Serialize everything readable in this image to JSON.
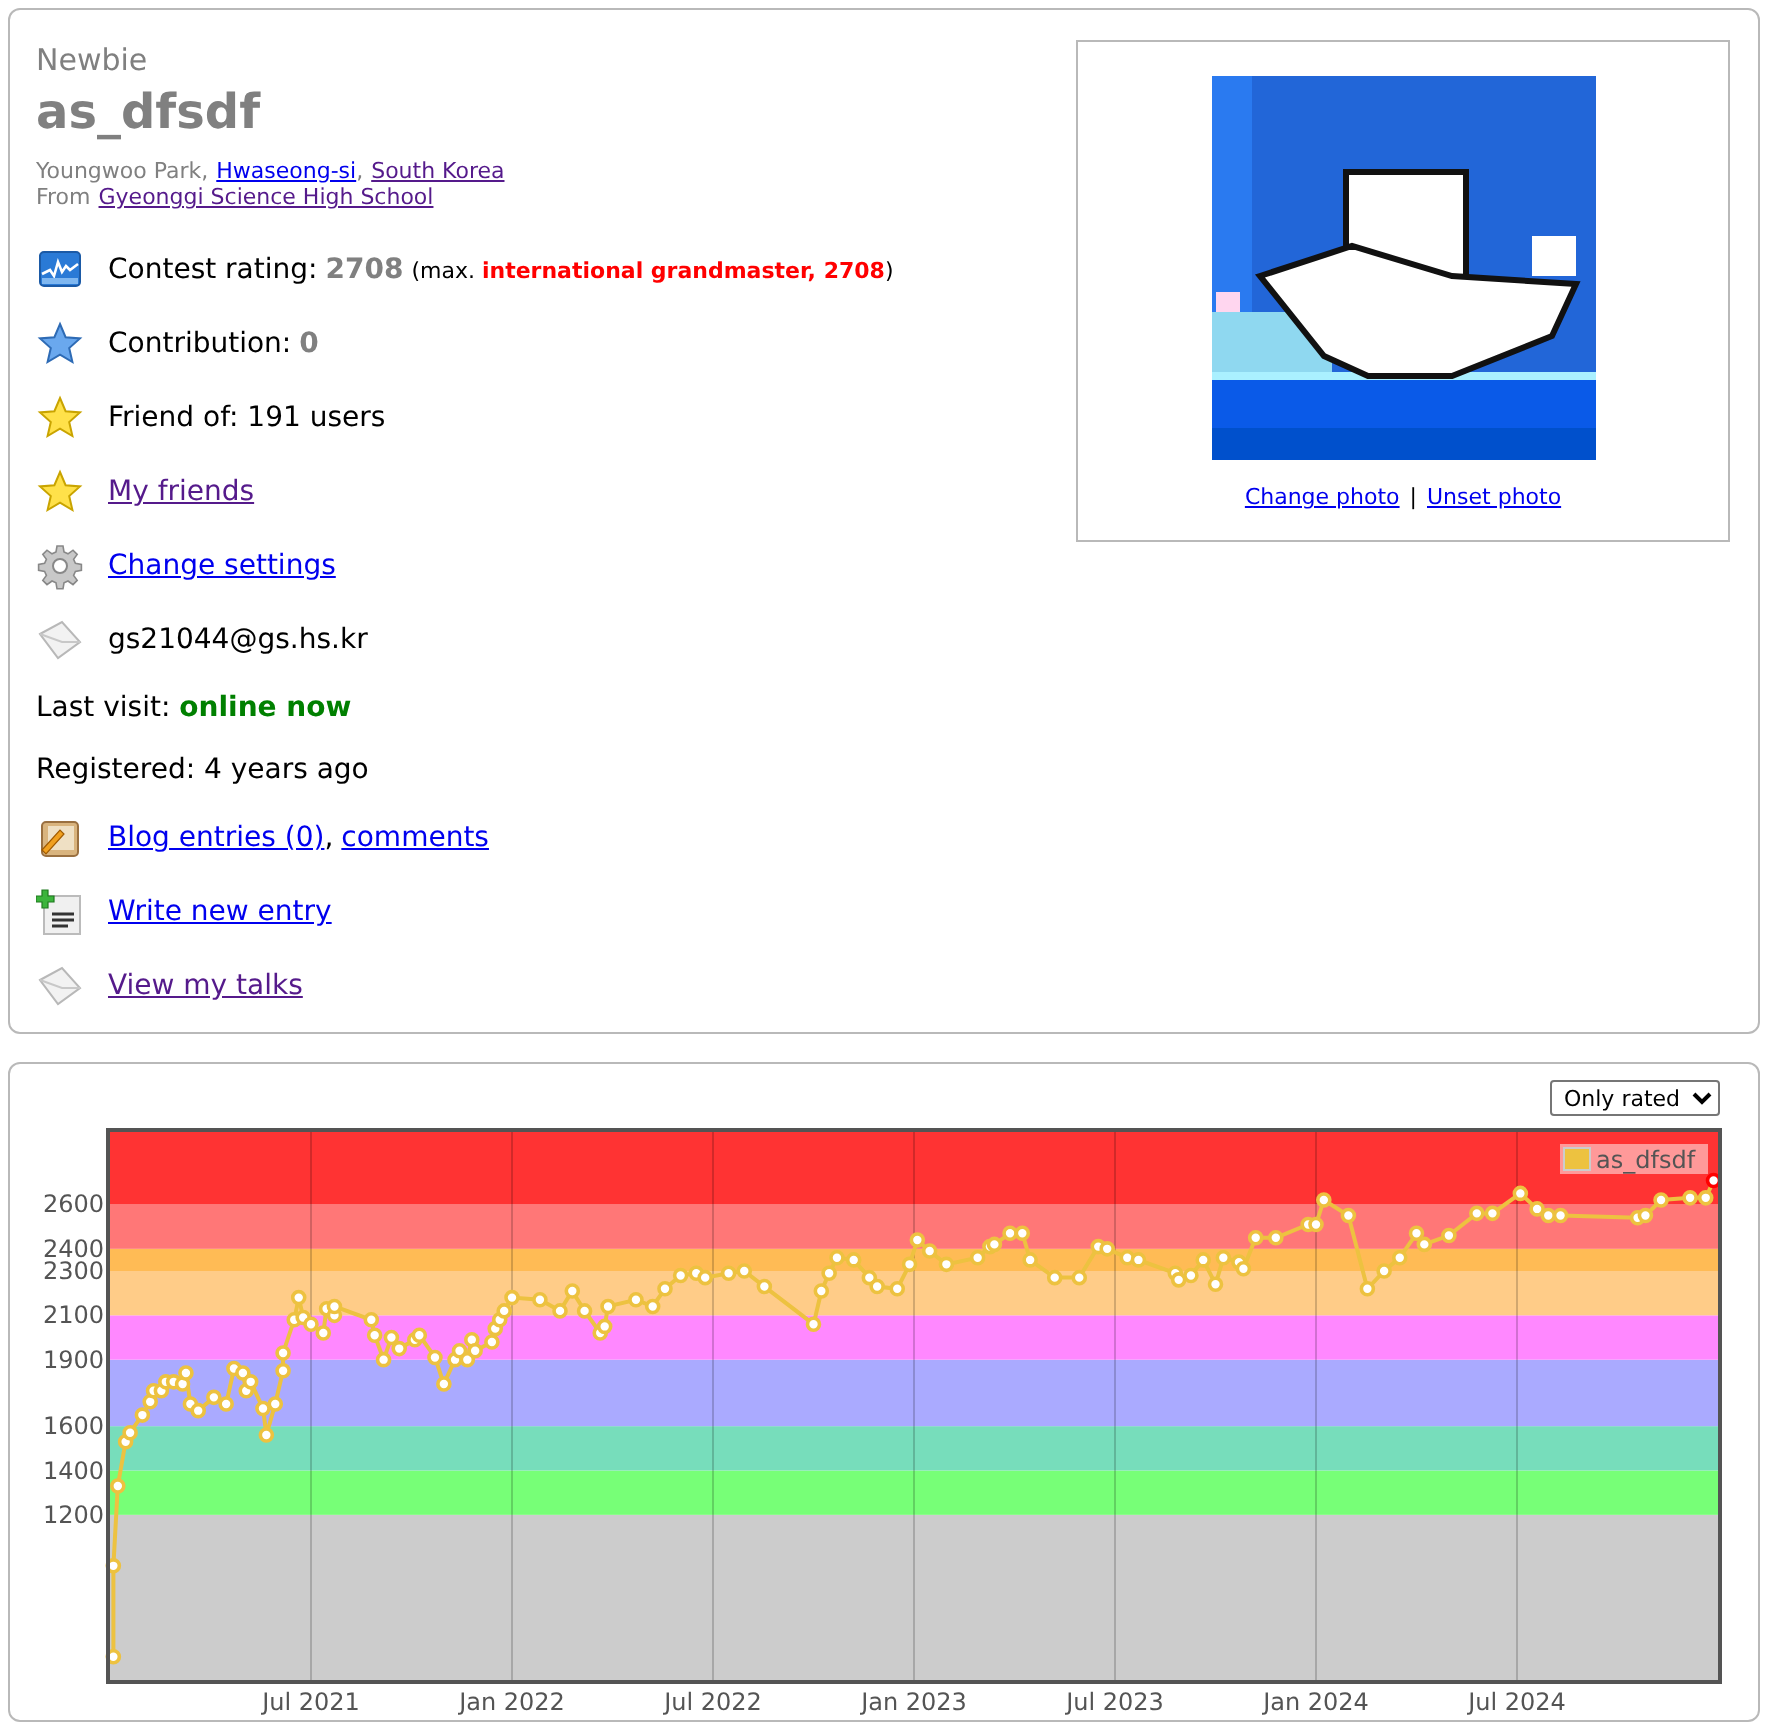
{
  "profile": {
    "rank": "Newbie",
    "handle": "as_dfsdf",
    "name_line": [
      {
        "kind": "text",
        "text": "Youngwoo Park,"
      },
      {
        "kind": "link",
        "text": "Hwaseong-si",
        "visited": false
      },
      {
        "kind": "text",
        "text": ","
      },
      {
        "kind": "link",
        "text": "South Korea",
        "visited": true
      }
    ],
    "organization_line": [
      {
        "kind": "text",
        "text": "From"
      },
      {
        "kind": "link",
        "text": "Gyeonggi Science High School",
        "visited": true
      }
    ],
    "rows": [
      {
        "kind": "rating",
        "label": "Contest rating:",
        "value": "2708",
        "max": "(max. **international grandmaster, 2708**)"
      },
      {
        "kind": "stat",
        "label": "Contribution:",
        "value": "0"
      },
      {
        "kind": "plain",
        "text": "Friend of: 191 users"
      },
      {
        "kind": "link",
        "text": "My friends",
        "visited": true
      },
      {
        "kind": "link",
        "text": "Change settings",
        "visited": false
      },
      {
        "kind": "plain",
        "text": "gs21044@gs.hs.kr"
      },
      {
        "kind": "status",
        "text": "Last visit: **online now**"
      },
      {
        "kind": "plain",
        "text": "Registered: 4 years ago"
      },
      {
        "kind": "links",
        "links": [
          {
            "text": "Blog entries (0)",
            "visited": false
          },
          {
            "text": "comments",
            "visited": false
          }
        ],
        "separator": ","
      },
      {
        "kind": "link",
        "text": "Write new entry",
        "visited": false
      },
      {
        "kind": "link",
        "text": "View my talks",
        "visited": true
      }
    ]
  },
  "photo": {
    "kind": "picture",
    "links": [
      {
        "text": "Change photo",
        "visited": false
      },
      {
        "text": "Unset photo",
        "visited": false
      }
    ],
    "separator": "|"
  },
  "rating_chart": {
    "filter": {
      "value": "Only rated"
    },
    "chart_data": {
      "type": "line",
      "grid": true,
      "bands": [
        {
          "axis": "y",
          "from": 455,
          "to": 1200,
          "color": "#cccccc"
        },
        {
          "axis": "y",
          "from": 1200,
          "to": 1400,
          "color": "#77ff77"
        },
        {
          "axis": "y",
          "from": 1400,
          "to": 1600,
          "color": "#77ddbb"
        },
        {
          "axis": "y",
          "from": 1600,
          "to": 1900,
          "color": "#aaaaff"
        },
        {
          "axis": "y",
          "from": 1900,
          "to": 2100,
          "color": "#ff88ff"
        },
        {
          "axis": "y",
          "from": 2100,
          "to": 2300,
          "color": "#ffcc88"
        },
        {
          "axis": "y",
          "from": 2300,
          "to": 2400,
          "color": "#ffbb55"
        },
        {
          "axis": "y",
          "from": 2400,
          "to": 2600,
          "color": "#ff7777"
        },
        {
          "axis": "y",
          "from": 2600,
          "to": 2927,
          "color": "#ff3333"
        }
      ],
      "xlim": [
        "2021-01-01",
        "2025-01-01"
      ],
      "ylim": [
        455,
        2927
      ],
      "xticks": [
        {
          "value": "2021-07-01",
          "label": "Jul 2021"
        },
        {
          "value": "2022-01-01",
          "label": "Jan 2022"
        },
        {
          "value": "2022-07-01",
          "label": "Jul 2022"
        },
        {
          "value": "2023-01-01",
          "label": "Jan 2023"
        },
        {
          "value": "2023-07-01",
          "label": "Jul 2023"
        },
        {
          "value": "2024-01-01",
          "label": "Jan 2024"
        },
        {
          "value": "2024-07-01",
          "label": "Jul 2024"
        }
      ],
      "yticks": [
        1200,
        1400,
        1600,
        1900,
        2100,
        2300,
        2400,
        2600
      ],
      "x": [
        "2021-01-04",
        "2021-01-04",
        "2021-01-08",
        "2021-01-15",
        "2021-01-19",
        "2021-01-30",
        "2021-02-07",
        "2021-02-10",
        "2021-02-17",
        "2021-02-21",
        "2021-02-28",
        "2021-03-06",
        "2021-03-09",
        "2021-03-13",
        "2021-03-20",
        "2021-04-04",
        "2021-04-15",
        "2021-04-22",
        "2021-04-30",
        "2021-05-03",
        "2021-05-07",
        "2021-05-18",
        "2021-05-21",
        "2021-05-29",
        "2021-06-06",
        "2021-06-06",
        "2021-06-16",
        "2021-06-20",
        "2021-06-24",
        "2021-07-01",
        "2021-07-12",
        "2021-07-15",
        "2021-07-22",
        "2021-07-22",
        "2021-08-25",
        "2021-08-28",
        "2021-09-06",
        "2021-09-13",
        "2021-09-20",
        "2021-10-04",
        "2021-10-08",
        "2021-10-22",
        "2021-10-30",
        "2021-11-10",
        "2021-11-14",
        "2021-11-21",
        "2021-11-25",
        "2021-11-28",
        "2021-12-13",
        "2021-12-16",
        "2021-12-20",
        "2021-12-24",
        "2022-01-01",
        "2022-01-26",
        "2022-02-14",
        "2022-02-25",
        "2022-03-06",
        "2022-03-20",
        "2022-03-24",
        "2022-03-27",
        "2022-04-22",
        "2022-05-07",
        "2022-05-18",
        "2022-06-02",
        "2022-06-16",
        "2022-06-24",
        "2022-07-15",
        "2022-07-29",
        "2022-08-17",
        "2022-10-01",
        "2022-10-08",
        "2022-10-15",
        "2022-10-22",
        "2022-11-07",
        "2022-11-21",
        "2022-11-28",
        "2022-12-16",
        "2022-12-27",
        "2023-01-04",
        "2023-01-15",
        "2023-01-30",
        "2023-02-28",
        "2023-03-09",
        "2023-03-13",
        "2023-03-27",
        "2023-04-08",
        "2023-04-15",
        "2023-05-07",
        "2023-05-29",
        "2023-06-16",
        "2023-06-24",
        "2023-07-12",
        "2023-07-22",
        "2023-08-25",
        "2023-08-28",
        "2023-09-09",
        "2023-09-20",
        "2023-10-01",
        "2023-10-08",
        "2023-10-22",
        "2023-10-26",
        "2023-11-07",
        "2023-11-25",
        "2023-12-24",
        "2024-01-01",
        "2024-01-08",
        "2024-01-30",
        "2024-02-17",
        "2024-03-02",
        "2024-03-16",
        "2024-04-01",
        "2024-04-08",
        "2024-04-30",
        "2024-05-25",
        "2024-06-09",
        "2024-07-04",
        "2024-07-19",
        "2024-07-29",
        "2024-08-10",
        "2024-10-19",
        "2024-10-26",
        "2024-11-10",
        "2024-12-06",
        "2024-12-20",
        "2024-12-27"
      ],
      "series": [
        {
          "name": "as_dfsdf",
          "color": "#edc240",
          "marker": true,
          "values": [
            560,
            970,
            1330,
            1530,
            1570,
            1650,
            1710,
            1760,
            1760,
            1800,
            1800,
            1790,
            1840,
            1700,
            1670,
            1730,
            1700,
            1860,
            1840,
            1760,
            1800,
            1680,
            1560,
            1700,
            1850,
            1930,
            2080,
            2180,
            2090,
            2060,
            2020,
            2130,
            2100,
            2140,
            2080,
            2010,
            1900,
            2000,
            1950,
            1990,
            2010,
            1910,
            1790,
            1900,
            1940,
            1900,
            1990,
            1940,
            1980,
            2040,
            2080,
            2120,
            2180,
            2170,
            2120,
            2210,
            2120,
            2020,
            2050,
            2140,
            2170,
            2140,
            2220,
            2280,
            2290,
            2270,
            2290,
            2300,
            2230,
            2060,
            2210,
            2290,
            2360,
            2350,
            2270,
            2230,
            2220,
            2330,
            2440,
            2390,
            2330,
            2360,
            2410,
            2420,
            2470,
            2470,
            2350,
            2270,
            2270,
            2410,
            2400,
            2360,
            2350,
            2290,
            2260,
            2280,
            2350,
            2240,
            2360,
            2340,
            2310,
            2450,
            2450,
            2510,
            2510,
            2620,
            2550,
            2220,
            2300,
            2360,
            2470,
            2420,
            2460,
            2560,
            2560,
            2650,
            2580,
            2550,
            2550,
            2540,
            2550,
            2620,
            2630,
            2630,
            2708
          ]
        }
      ]
    }
  }
}
